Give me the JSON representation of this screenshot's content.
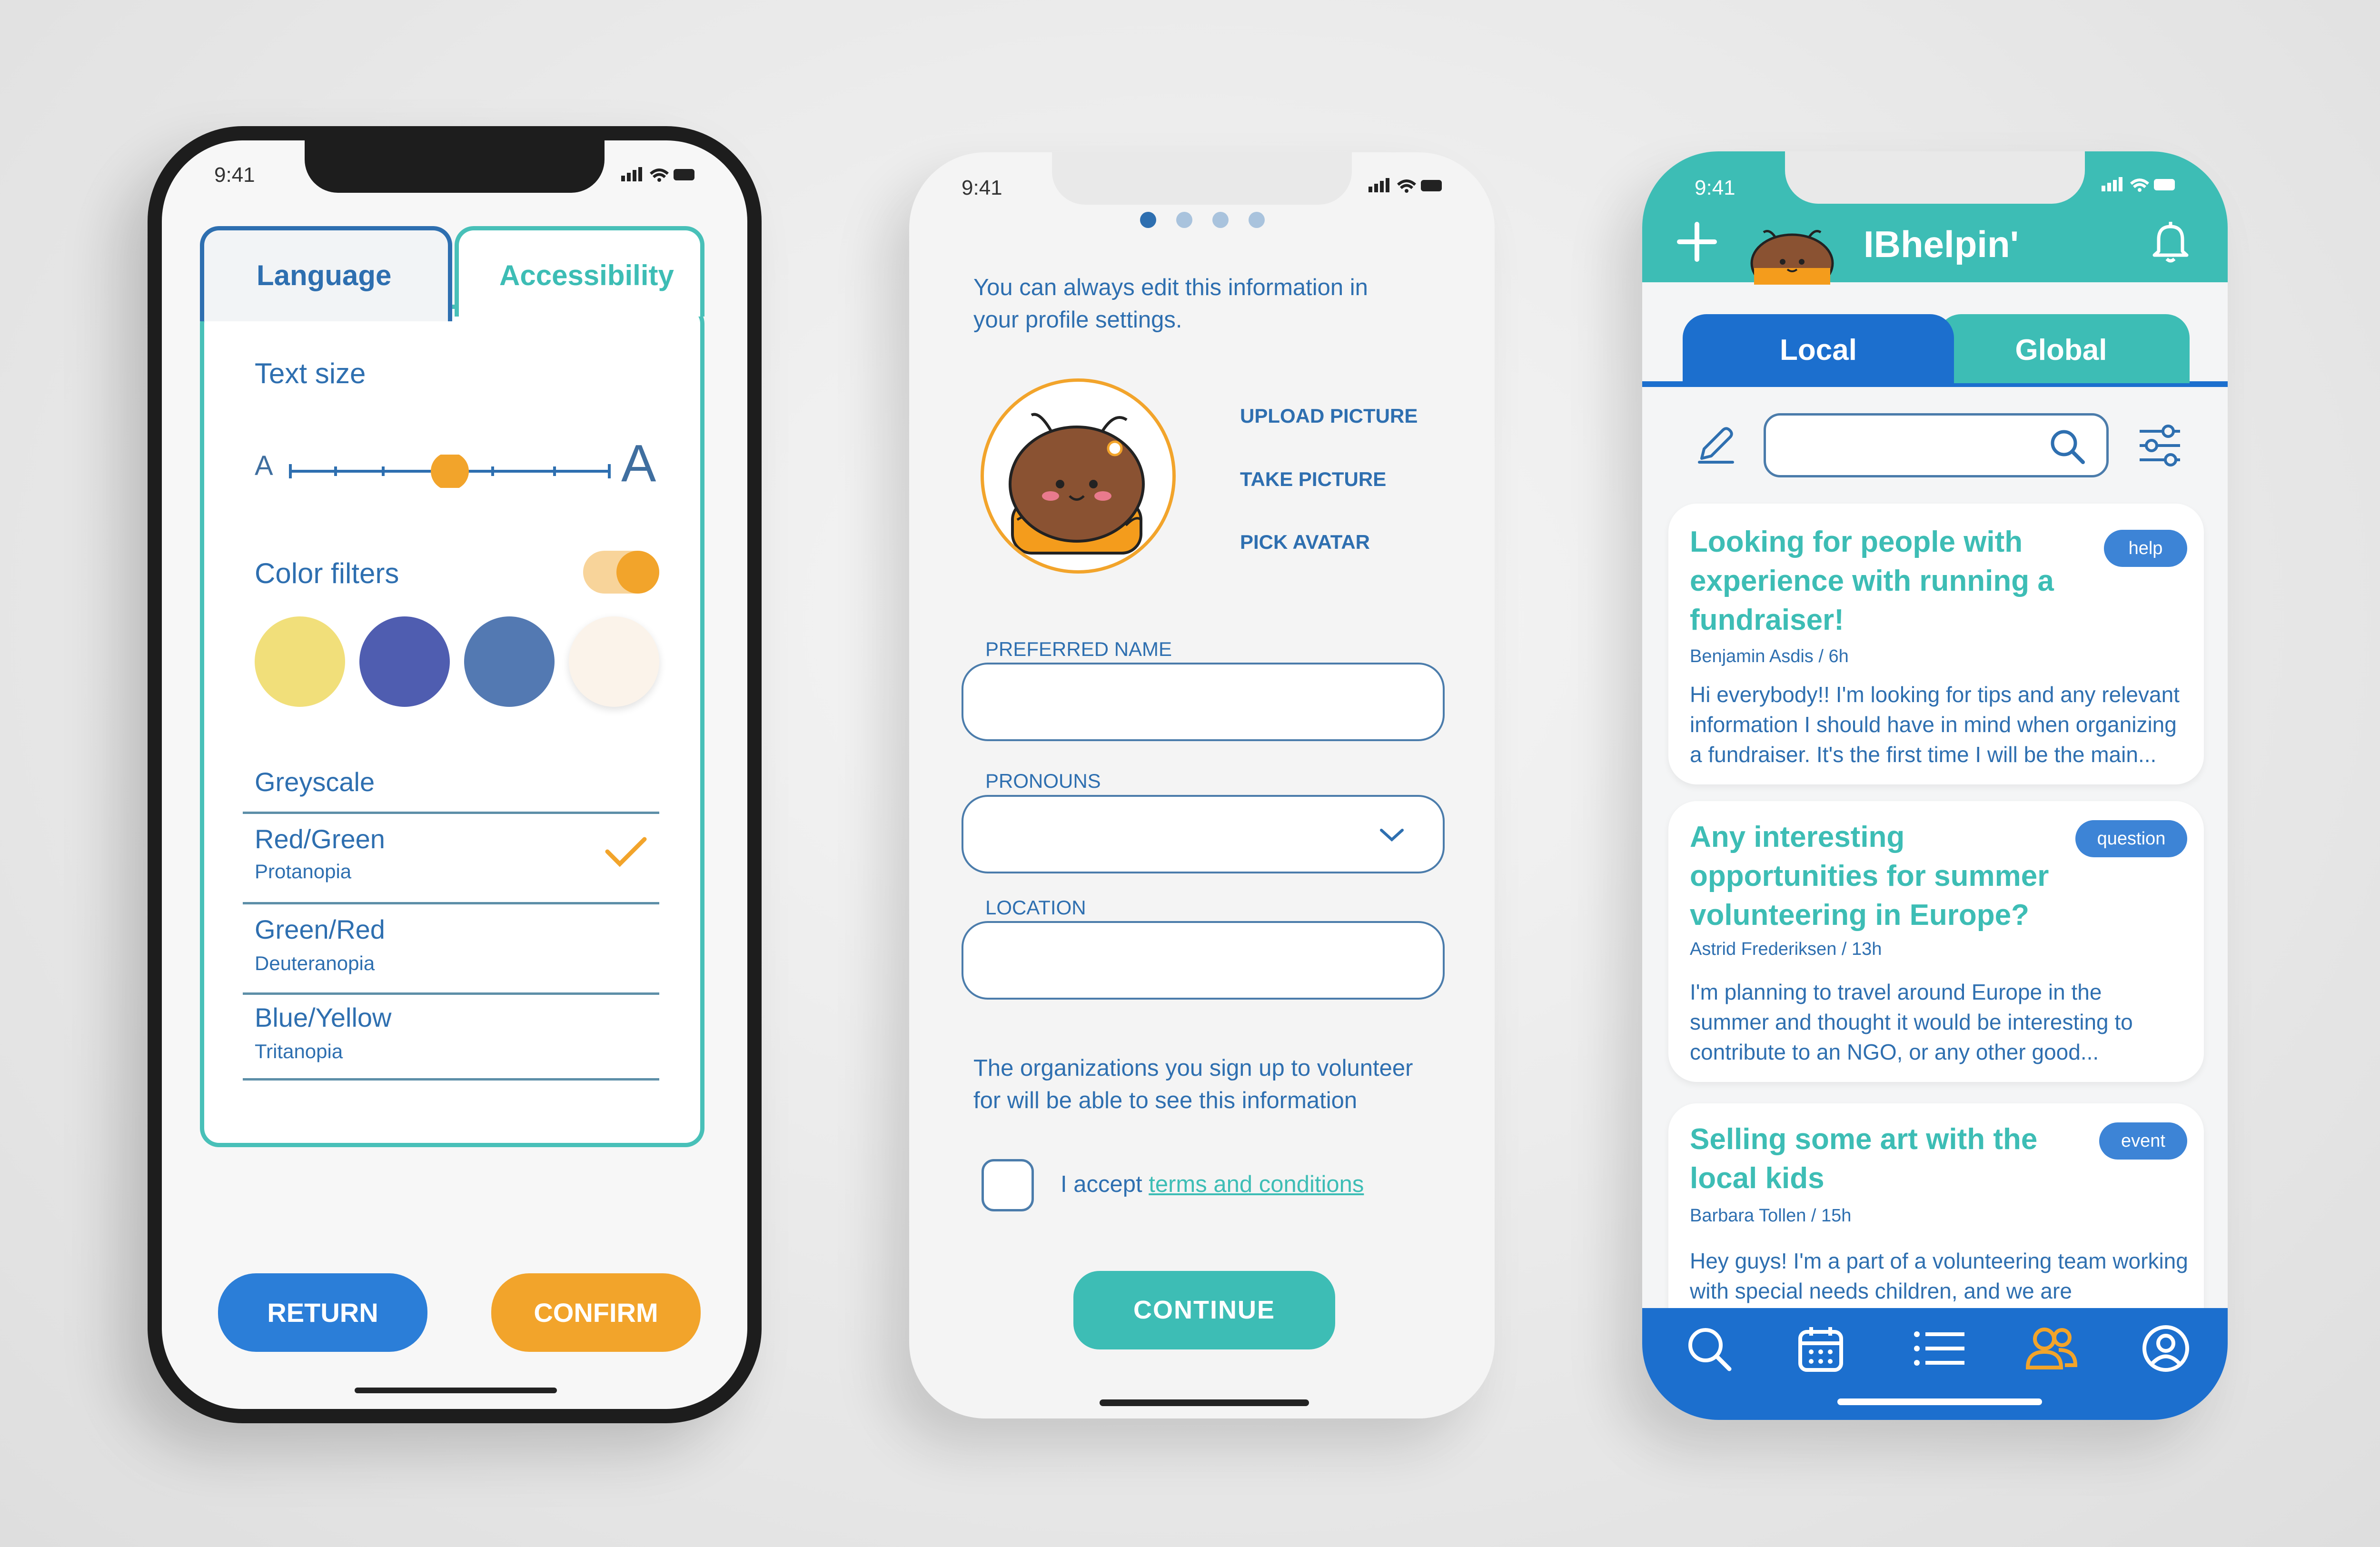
{
  "phone1": {
    "status_time": "9:41",
    "tabs": [
      {
        "label": "Language"
      },
      {
        "label": "Accessibility"
      }
    ],
    "text_size_label": "Text size",
    "text_small": "A",
    "text_large": "A",
    "text_size_level": 0.5,
    "color_filters_label": "Color filters",
    "color_filters_on": true,
    "swatches": [
      "#f1df7a",
      "#4f5db0",
      "#5379b2",
      "#fbf3ea"
    ],
    "filters": [
      {
        "name": "Greyscale",
        "sub": ""
      },
      {
        "name": "Red/Green",
        "sub": "Protanopia",
        "selected": true
      },
      {
        "name": "Green/Red",
        "sub": "Deuteranopia"
      },
      {
        "name": "Blue/Yellow",
        "sub": "Tritanopia"
      }
    ],
    "return_label": "RETURN",
    "confirm_label": "CONFIRM"
  },
  "phone2": {
    "status_time": "9:41",
    "page_dots": 4,
    "active_dot": 0,
    "intro": "You can always edit this information in your profile settings.",
    "picture_options": [
      "UPLOAD PICTURE",
      "TAKE PICTURE",
      "PICK AVATAR"
    ],
    "preferred_name_label": "PREFERRED NAME",
    "pronouns_label": "PRONOUNS",
    "location_label": "LOCATION",
    "info_note": "The organizations you sign up to volunteer for will be able to see this information",
    "accept_prefix": "I accept ",
    "terms_link": "terms and conditions",
    "continue_label": "CONTINUE"
  },
  "phone3": {
    "status_time": "9:41",
    "app_title": "IBhelpin'",
    "tabs": [
      {
        "label": "Local",
        "active": true
      },
      {
        "label": "Global"
      }
    ],
    "search_placeholder": "",
    "posts": [
      {
        "title": "Looking for people with experience with running a fundraiser!",
        "tag": "help",
        "meta": "Benjamin Asdis / 6h",
        "body": "Hi everybody!! I'm looking for tips and any relevant information I should have in mind when organizing a fundraiser. It's the first time I will be the main..."
      },
      {
        "title": "Any interesting opportunities for summer volunteering in Europe?",
        "tag": "question",
        "meta": "Astrid Frederiksen / 13h",
        "body": "I'm planning to travel around Europe in the summer and thought it would be interesting to contribute to an NGO, or any other good..."
      },
      {
        "title": "Selling some art with the local kids",
        "tag": "event",
        "meta": "Barbara Tollen / 15h",
        "body": "Hey guys! I'm a part of a volunteering team working with special needs children, and we are"
      }
    ],
    "nav_icons": [
      "search-icon",
      "calendar-icon",
      "list-icon",
      "community-icon",
      "profile-icon"
    ],
    "active_nav": "community-icon"
  },
  "colors": {
    "teal": "#3dbdb5",
    "blue": "#1c6fce",
    "orange": "#f2a42b",
    "text_blue": "#2e6fb0"
  }
}
